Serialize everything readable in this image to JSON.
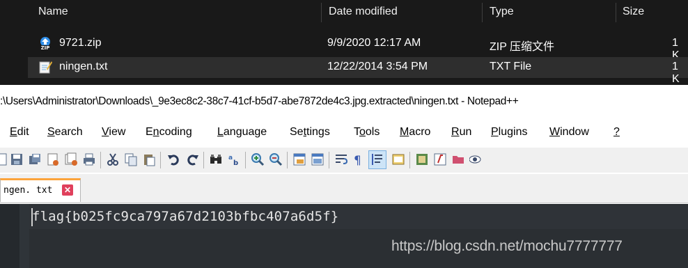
{
  "explorer": {
    "columns": [
      "Name",
      "Date modified",
      "Type",
      "Size"
    ],
    "files": [
      {
        "name": "9721.zip",
        "date": "9/9/2020 12:17 AM",
        "type": "ZIP 压缩文件",
        "size": "1 K",
        "icon": "zip-archive-icon"
      },
      {
        "name": "ningen.txt",
        "date": "12/22/2014 3:54 PM",
        "type": "TXT File",
        "size": "1 K",
        "icon": "text-file-icon"
      }
    ]
  },
  "notepad": {
    "title": ":\\Users\\Administrator\\Downloads\\_9e3ec8c2-38c7-41cf-b5d7-abe7872de4c3.jpg.extracted\\ningen.txt - Notepad++",
    "menu": [
      "Edit",
      "Search",
      "View",
      "Encoding",
      "Language",
      "Settings",
      "Tools",
      "Macro",
      "Run",
      "Plugins",
      "Window",
      "?"
    ],
    "tab_label": "ngen. txt",
    "editor_text": "flag{b025fc9ca797a67d2103bfbc407a6d5f}",
    "watermark": "https://blog.csdn.net/mochu7777777"
  },
  "colors": {
    "explorer_bg": "#191919",
    "selected_row": "#2e2e2e",
    "tab_accent": "#fca43c",
    "tab_close": "#e0405c",
    "editor_bg": "#2b2f33"
  }
}
